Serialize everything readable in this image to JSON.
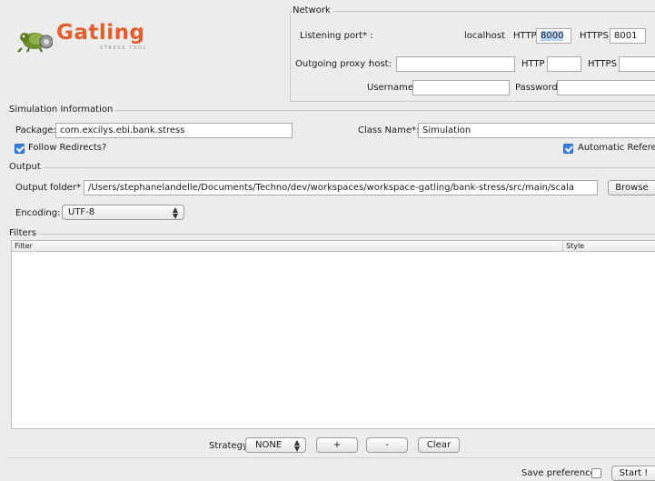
{
  "logo": {
    "name": "Gatling",
    "tagline": "STRESS TOOL"
  },
  "network": {
    "legend": "Network",
    "listening_port_label": "Listening port* :",
    "localhost_label": "localhost",
    "http_label": "HTTP",
    "http_port": "8000",
    "https_label": "HTTPS",
    "https_port": "8001",
    "proxy_label": "Outgoing proxy :",
    "host_label": "host:",
    "proxy_host": "",
    "proxy_http_label": "HTTP",
    "proxy_http": "",
    "proxy_https_label": "HTTPS",
    "proxy_https": "",
    "username_label": "Username",
    "username": "",
    "password_label": "Password",
    "password": ""
  },
  "simulation": {
    "legend": "Simulation Information",
    "package_label": "Package:",
    "package": "com.excilys.ebi.bank.stress",
    "class_label": "Class Name*:",
    "class_name": "Simulation",
    "follow_redirects_label": "Follow Redirects?",
    "follow_redirects": true,
    "auto_referers_label": "Automatic Referers?",
    "auto_referers": true
  },
  "output": {
    "legend": "Output",
    "folder_label": "Output folder* :",
    "folder": "/Users/stephanelandelle/Documents/Techno/dev/workspaces/workspace-gatling/bank-stress/src/main/scala",
    "browse_label": "Browse",
    "encoding_label": "Encoding:",
    "encoding": "UTF-8"
  },
  "filters": {
    "legend": "Filters",
    "columns": [
      "Filter",
      "Style"
    ],
    "rows": [],
    "strategy_label": "Strategy",
    "strategy": "NONE",
    "add_label": "+",
    "remove_label": "-",
    "clear_label": "Clear"
  },
  "footer": {
    "save_preferences_label": "Save preferences",
    "save_preferences": false,
    "start_label": "Start !"
  },
  "colors": {
    "logo_orange": "#e35d2d",
    "selection": "#b5d1f7",
    "check_blue": "#3a82e4"
  }
}
